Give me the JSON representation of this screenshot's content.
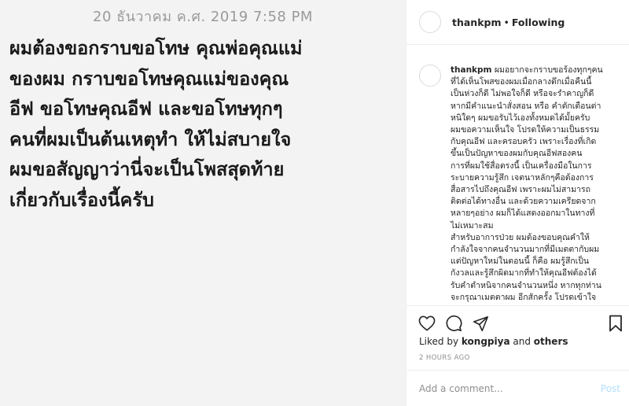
{
  "image": {
    "date": "20 ธันวาคม ค.ศ. 2019 7:58 PM",
    "lines": [
      "ผมต้องขอกราบขอโทษ คุณพ่อคุณแม่",
      "ของผม  กราบขอโทษคุณแม่ของคุณ",
      "อีฟ ขอโทษคุณอีฟ และขอโทษทุกๆ",
      "คนที่ผมเป็นต้นเหตุทำ ให้ไม่สบายใจ",
      "ผมขอสัญญาว่านี่จะเป็นโพสสุดท้าย",
      "เกี่ยวกับเรื่องนี้ครับ"
    ]
  },
  "header": {
    "username": "thankpm",
    "separator": "•",
    "follow_status": "Following"
  },
  "caption": {
    "username": "thankpm",
    "first_line": "ผมอยากจะกราบขอร้องทุกๆคน",
    "lines": [
      "ที่ได้เห็นโพสของผมเมื่อกลางดึกเมื่อคืนนี้",
      "เป็นห่วงก็ดี ไม่พอใจก็ดี หรือจะรำคาญก็ดี",
      "หากมีคำแนะนำสั่งสอน หรือ คำตักเตือนต่า",
      "หนิใดๆ ผมขอรับไว้เองทั้งหมดได้มั้ยครับ",
      "ผมขอความเห็นใจ โปรดให้ความเป็นธรรม",
      "กับคุณอีฟ และครอบครัว เพราะเรื่องที่เกิด",
      "ขึ้นเป็นปัญหาของผมกับคุณอีฟสองคน",
      "การที่ผมใช้สื่อตรงนี้ เป็นเครื่องมือในการ",
      "ระบายความรู้สึก เจตนาหลักๆคือต้องการ",
      "สื่อสารไปถึงคุณอีฟ เพราะผมไม่สามารถ",
      "ติดต่อได้ทางอื่น และด้วยความเครียดจาก",
      "หลายๆอย่าง ผมก็ได้แสดงออกมาในทางที่",
      "ไม่เหมาะสม",
      "สำหรับอาการป่วย ผมต้องขอบคุณคำให้",
      "กำลังใจจากคนจำนวนมากที่มีเมตตากับผม",
      "แต่ปัญหาใหม่ในตอนนี้ ก็คือ ผมรู้สึกเป็น",
      "กังวลและรู้สึกผิดมากที่ทำให้คุณอีฟต้องได้",
      "รับคำตำหนิจากคนจำนวนหนึ่ง หากทุกท่าน",
      "จะกรุณาเมตตาผม อีกสักครั้ง โปรดเข้าใจ"
    ]
  },
  "actions": {
    "like_icon": "heart-icon",
    "comment_icon": "comment-icon",
    "share_icon": "share-icon",
    "save_icon": "bookmark-icon"
  },
  "likes": {
    "prefix": "Liked by ",
    "user": "kongpiya",
    "and": " and ",
    "others": "others"
  },
  "timestamp": "2 HOURS AGO",
  "comment": {
    "placeholder": "Add a comment...",
    "post_label": "Post"
  },
  "colors": {
    "background": "#f3f3f3",
    "post_disabled": "#b2dffc",
    "muted": "#8e8e8e"
  }
}
